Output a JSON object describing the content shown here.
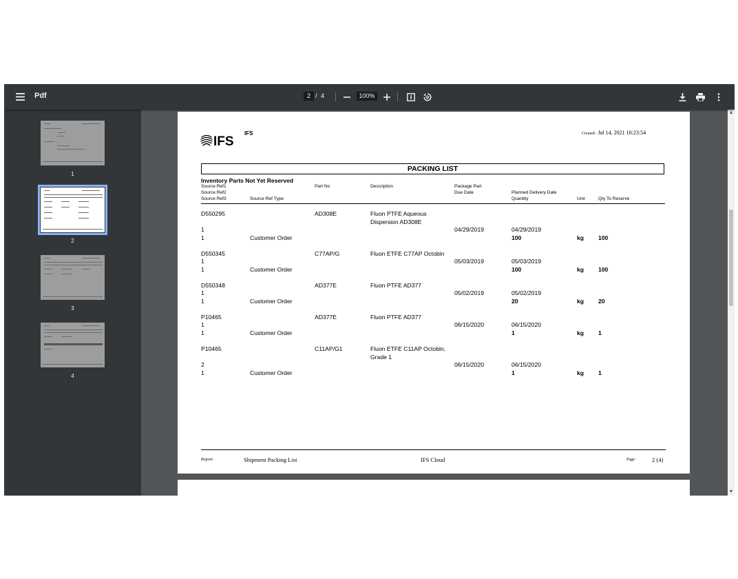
{
  "toolbar": {
    "title": "Pdf",
    "current_page": "2",
    "page_separator": "/",
    "total_pages": "4",
    "zoom": "100%"
  },
  "thumbnails": [
    {
      "label": "1"
    },
    {
      "label": "2"
    },
    {
      "label": "3"
    },
    {
      "label": "4"
    }
  ],
  "document": {
    "company": "IFS",
    "created_label": "Created:",
    "created_value": "Jul 14, 2021 10:23:54",
    "title": "PACKING LIST",
    "section_title": "Inventory Parts Not Yet Reserved",
    "headers": {
      "source_ref1": "Source Ref1",
      "source_ref2": "Source Ref2",
      "source_ref3": "Source Ref3",
      "source_ref_type": "Source Ref Type",
      "part_no": "Part No",
      "description": "Description",
      "package_part": "Package Part",
      "due_date": "Due Date",
      "planned_delivery_date": "Planned Delivery Date",
      "quantity": "Quantity",
      "unit": "Unit",
      "qty_to_reserve": "Qty To Reserve"
    },
    "rows": [
      {
        "ref1": "D550295",
        "part_no": "AD308E",
        "desc1": "Fluon PTFE Aqueous",
        "desc2": "Dispersion AD308E",
        "ref2": "1",
        "due_date": "04/29/2019",
        "planned_date": "04/29/2019",
        "ref3": "1",
        "ref_type": "Customer Order",
        "quantity": "100",
        "unit": "kg",
        "qty_reserve": "100"
      },
      {
        "ref1": "D550345",
        "part_no": "C77AP/G",
        "desc1": "Fluon ETFE C77AP Octobin",
        "ref2": "1",
        "due_date": "05/03/2019",
        "planned_date": "05/03/2019",
        "ref3": "1",
        "ref_type": "Customer Order",
        "quantity": "100",
        "unit": "kg",
        "qty_reserve": "100"
      },
      {
        "ref1": "D550348",
        "part_no": "AD377E",
        "desc1": "Fluon PTFE AD377",
        "ref2": "1",
        "due_date": "05/02/2019",
        "planned_date": "05/02/2019",
        "ref3": "1",
        "ref_type": "Customer Order",
        "quantity": "20",
        "unit": "kg",
        "qty_reserve": "20"
      },
      {
        "ref1": "P10465",
        "part_no": "AD377E",
        "desc1": "Fluon PTFE AD377",
        "ref2": "1",
        "due_date": "06/15/2020",
        "planned_date": "06/15/2020",
        "ref3": "1",
        "ref_type": "Customer Order",
        "quantity": "1",
        "unit": "kg",
        "qty_reserve": "1"
      },
      {
        "ref1": "P10465",
        "part_no": "C11AP/G1",
        "desc1": "Fluon ETFE C11AP Octobin,",
        "desc2": "Grade 1",
        "ref2": "2",
        "due_date": "06/15/2020",
        "planned_date": "06/15/2020",
        "ref3": "1",
        "ref_type": "Customer Order",
        "quantity": "1",
        "unit": "kg",
        "qty_reserve": "1"
      }
    ],
    "footer": {
      "report_label": "Report:",
      "report_name": "Shipment Packing List",
      "product": "IFS Cloud",
      "page_label": "Page:",
      "page_value": "2 (4)"
    }
  },
  "icons": {
    "menu": "hamburger-icon",
    "zoom_out": "minus-icon",
    "zoom_in": "plus-icon",
    "fit": "fit-page-icon",
    "rotate": "rotate-icon",
    "download": "download-icon",
    "print": "print-icon",
    "more": "more-vert-icon"
  },
  "colors": {
    "toolbar_bg": "#323639",
    "viewer_bg": "#525659",
    "active_thumb_outline": "#8ab4f8"
  }
}
